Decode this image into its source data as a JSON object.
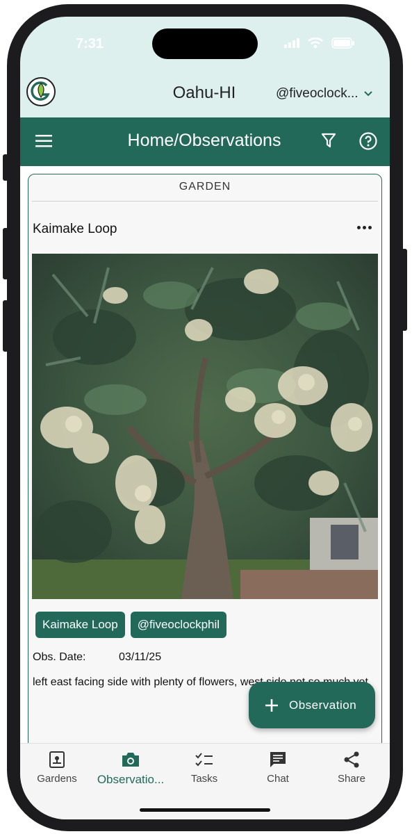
{
  "status": {
    "time": "7:31"
  },
  "header": {
    "site_title": "Oahu-HI",
    "user": "@fiveoclock..."
  },
  "appbar": {
    "title": "Home/Observations"
  },
  "card": {
    "section_label": "GARDEN",
    "title": "Kaimake Loop",
    "chips": [
      "Kaimake Loop",
      "@fiveoclockphil"
    ],
    "date_label": "Obs. Date:",
    "date_value": "03/11/25",
    "notes": "left east facing side with plenty of flowers, west side not so much yet."
  },
  "fab": {
    "label": "Observation"
  },
  "nav": {
    "items": [
      {
        "label": "Gardens",
        "icon": "garden-icon"
      },
      {
        "label": "Observatio...",
        "icon": "camera-icon"
      },
      {
        "label": "Tasks",
        "icon": "checklist-icon"
      },
      {
        "label": "Chat",
        "icon": "chat-icon"
      },
      {
        "label": "Share",
        "icon": "share-icon"
      }
    ]
  },
  "colors": {
    "primary": "#23695a",
    "header_bg": "#ddf0ee"
  }
}
